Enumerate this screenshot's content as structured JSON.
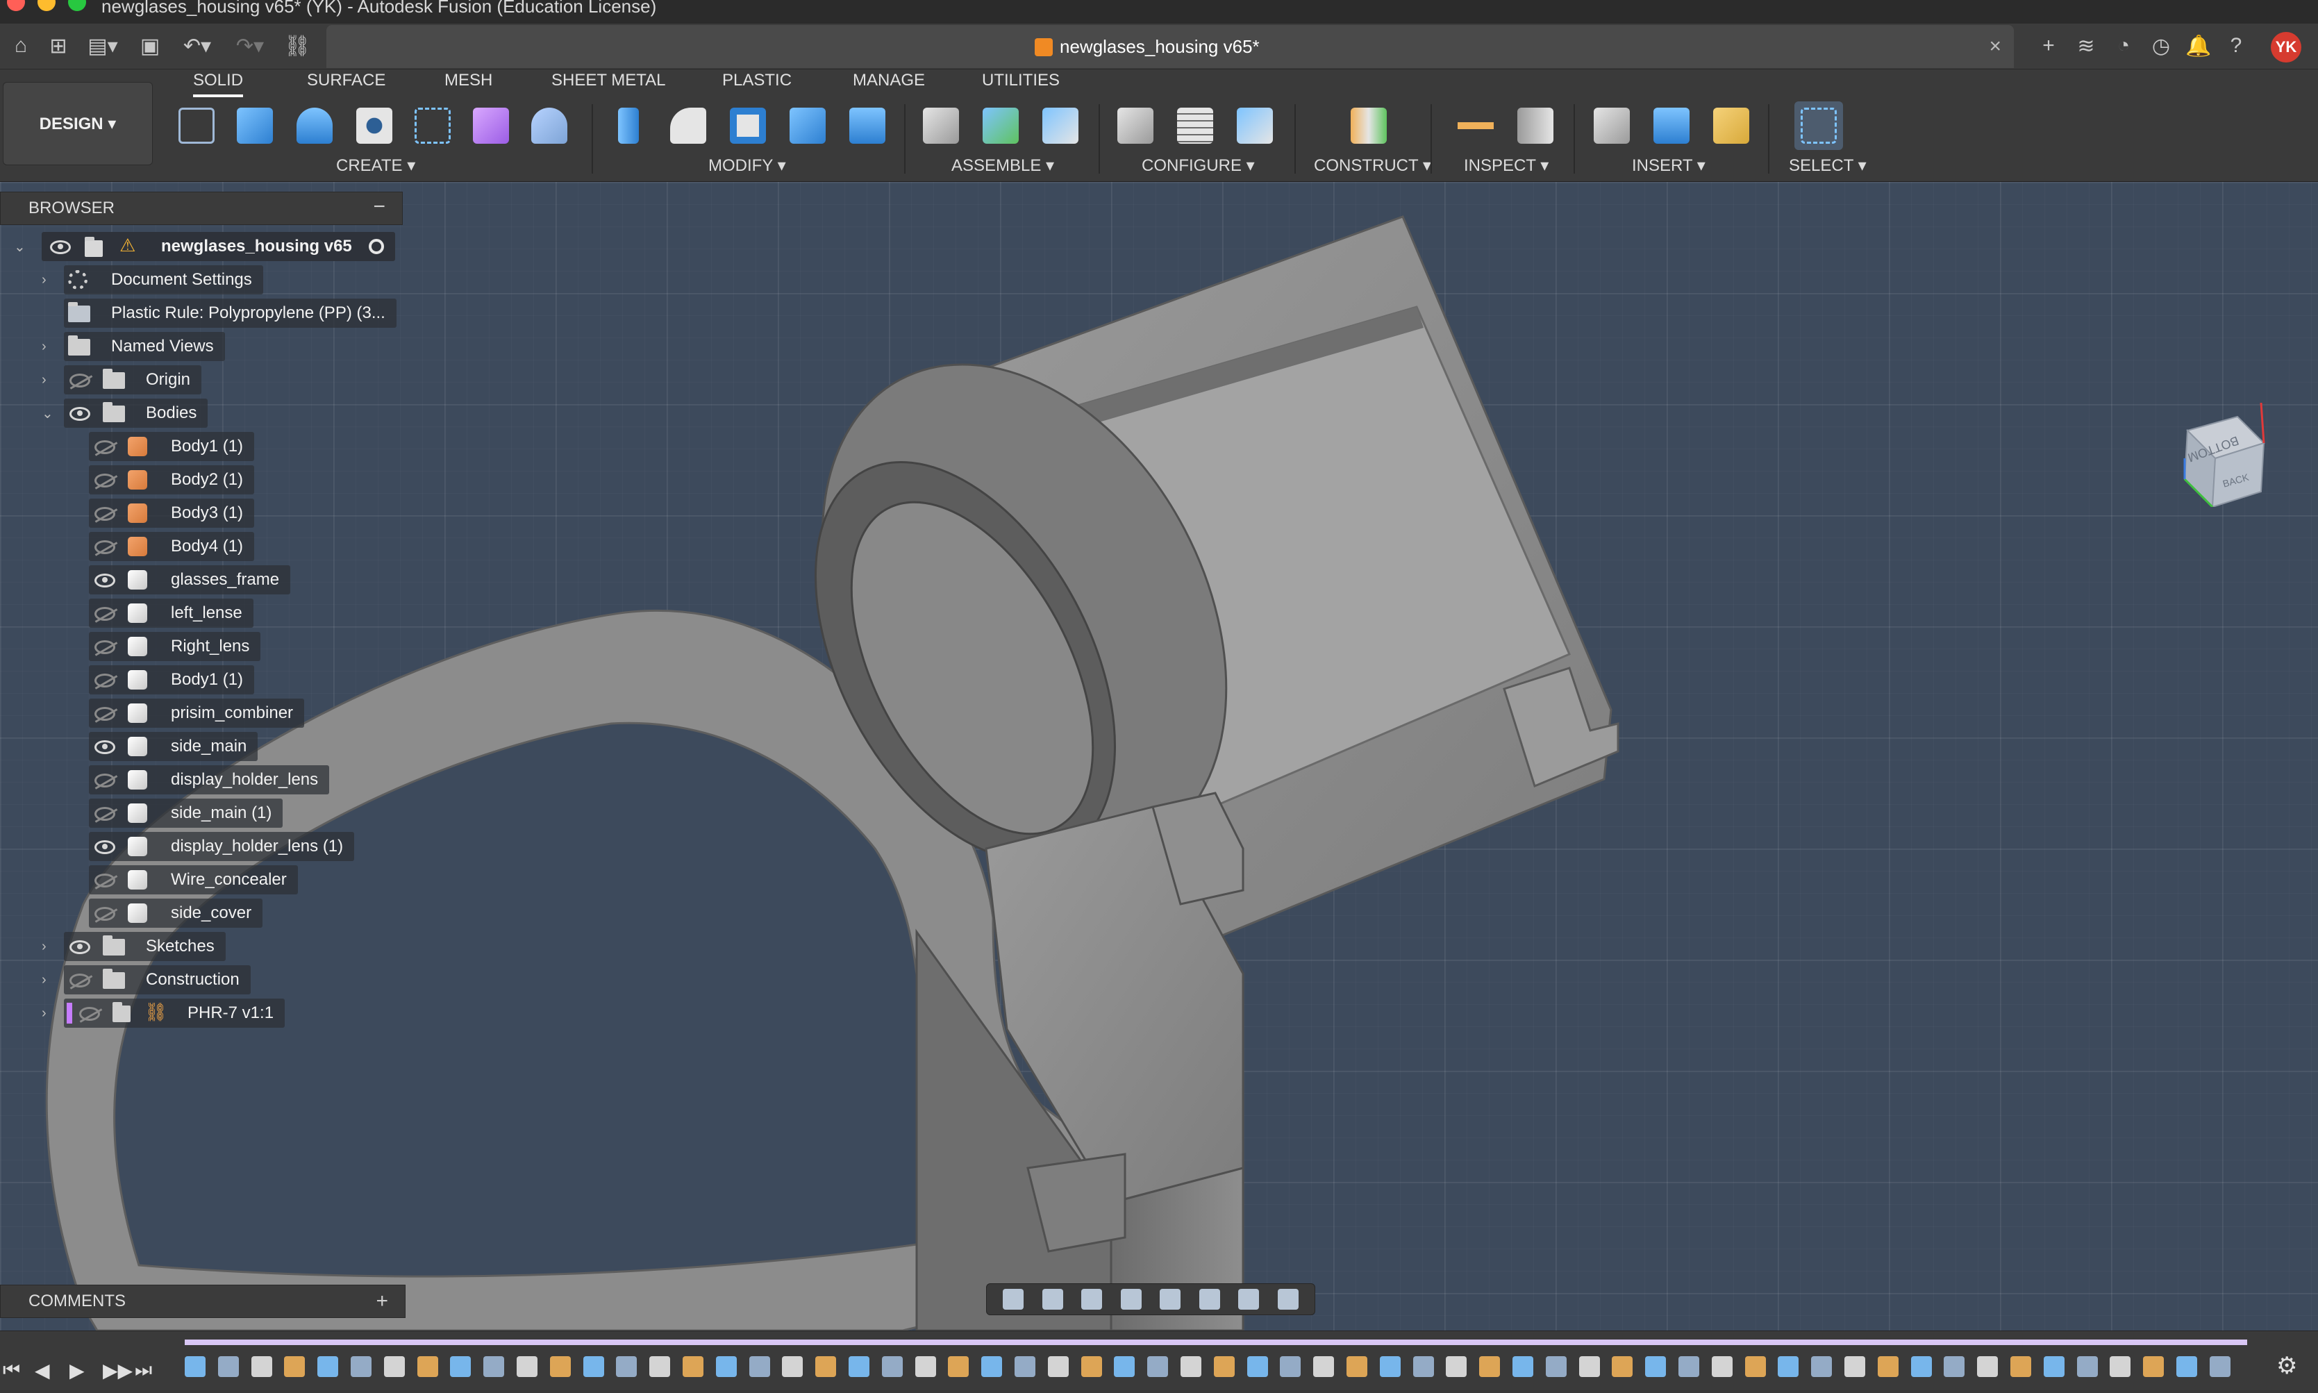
{
  "window": {
    "title": "newglases_housing v65* (YK) - Autodesk Fusion (Education License)"
  },
  "appbar": {
    "doc_tab": "newglases_housing v65*",
    "avatar": "YK"
  },
  "toolbar": {
    "workspace": "DESIGN ▾",
    "tabs": [
      "SOLID",
      "SURFACE",
      "MESH",
      "SHEET METAL",
      "PLASTIC",
      "MANAGE",
      "UTILITIES"
    ],
    "groups": [
      "CREATE ▾",
      "MODIFY ▾",
      "ASSEMBLE ▾",
      "CONFIGURE ▾",
      "CONSTRUCT ▾",
      "INSPECT ▾",
      "INSERT ▾",
      "SELECT ▾"
    ]
  },
  "browser": {
    "title": "BROWSER",
    "collapse": "−",
    "root": "newglases_housing v65",
    "items": [
      {
        "label": "Document Settings",
        "icon": "gear-icon"
      },
      {
        "label": "Plastic Rule: Polypropylene (PP) (3...",
        "icon": "plastic-rule-icon"
      },
      {
        "label": "Named Views",
        "icon": "folder-icon"
      },
      {
        "label": "Origin",
        "icon": "folder-icon"
      },
      {
        "label": "Bodies",
        "icon": "folder-icon"
      },
      {
        "label": "Body1 (1)",
        "icon": "body-orange-icon"
      },
      {
        "label": "Body2 (1)",
        "icon": "body-orange-icon"
      },
      {
        "label": "Body3 (1)",
        "icon": "body-orange-icon"
      },
      {
        "label": "Body4 (1)",
        "icon": "body-orange-icon"
      },
      {
        "label": "glasses_frame",
        "icon": "body-icon"
      },
      {
        "label": "left_lense",
        "icon": "body-icon"
      },
      {
        "label": "Right_lens",
        "icon": "body-icon"
      },
      {
        "label": "Body1 (1)",
        "icon": "body-icon"
      },
      {
        "label": "prisim_combiner",
        "icon": "body-icon"
      },
      {
        "label": "side_main",
        "icon": "body-icon"
      },
      {
        "label": "display_holder_lens",
        "icon": "body-icon"
      },
      {
        "label": "side_main (1)",
        "icon": "body-icon"
      },
      {
        "label": "display_holder_lens (1)",
        "icon": "body-icon"
      },
      {
        "label": "Wire_concealer",
        "icon": "body-icon"
      },
      {
        "label": "side_cover",
        "icon": "body-icon"
      },
      {
        "label": "Sketches",
        "icon": "folder-icon"
      },
      {
        "label": "Construction",
        "icon": "folder-icon"
      },
      {
        "label": "PHR-7 v1:1",
        "icon": "linked-component-icon"
      }
    ]
  },
  "comments": {
    "title": "COMMENTS",
    "add": "+"
  },
  "viewcube": {
    "face": "BOTTOM",
    "side": "BACK"
  },
  "colors": {
    "viewport_bg": "#3d4a5c",
    "model_gray": "#8a8a8a",
    "accent_orange": "#f08a24",
    "avatar_red": "#d63b2f",
    "timeline_track": "#d9c7f5"
  }
}
